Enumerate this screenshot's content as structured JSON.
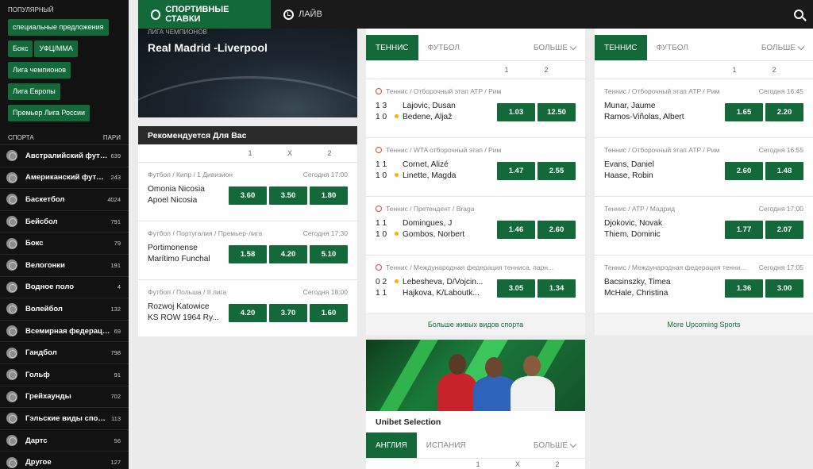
{
  "sidebar": {
    "popular_caption": "ПОПУЛЯРНЫЙ",
    "popular": [
      "специальные предложения",
      "Бокс",
      "УФЦ/ММА",
      "Лига чемпионов",
      "Лига Европы",
      "Премьер Лига России"
    ],
    "sports_caption": "СПОРТА",
    "bets_caption": "ПАРИ",
    "sports": [
      {
        "label": "Австралийский футбол",
        "count": "639",
        "icon": "australian-football-icon"
      },
      {
        "label": "Американский футбол",
        "count": "243",
        "icon": "american-football-icon"
      },
      {
        "label": "Баскетбол",
        "count": "4024",
        "icon": "basketball-icon"
      },
      {
        "label": "Бейсбол",
        "count": "791",
        "icon": "baseball-icon"
      },
      {
        "label": "Бокс",
        "count": "79",
        "icon": "boxing-icon"
      },
      {
        "label": "Велогонки",
        "count": "191",
        "icon": "cycling-icon"
      },
      {
        "label": "Водное поло",
        "count": "4",
        "icon": "water-polo-icon"
      },
      {
        "label": "Волейбол",
        "count": "132",
        "icon": "volleyball-icon"
      },
      {
        "label": "Всемирная федерация р...",
        "count": "69",
        "icon": "rugby-icon"
      },
      {
        "label": "Гандбол",
        "count": "798",
        "icon": "handball-icon"
      },
      {
        "label": "Гольф",
        "count": "91",
        "icon": "golf-icon"
      },
      {
        "label": "Грейхаунды",
        "count": "702",
        "icon": "greyhound-icon"
      },
      {
        "label": "Гэльские виды спорта",
        "count": "113",
        "icon": "gaelic-sports-icon"
      },
      {
        "label": "Дартс",
        "count": "56",
        "icon": "darts-icon"
      },
      {
        "label": "Другое",
        "count": "127",
        "icon": "star-icon"
      }
    ]
  },
  "nav": {
    "sports_bets": "СПОРТИВНЫЕ СТАВКИ",
    "live": "ЛАЙВ"
  },
  "hero": {
    "category": "ЛИГА ЧЕМПИОНОВ",
    "title": "Real Madrid -Liverpool"
  },
  "recommended": {
    "title": "Рекомендуется Для Вас",
    "cols": [
      "1",
      "X",
      "2"
    ],
    "events": [
      {
        "meta": "Футбол / Кипр / 1 Дивизион",
        "time": "Сегодня 17:00",
        "team1": "Omonia Nicosia",
        "team2": "Apoel Nicosia",
        "odds": [
          "3.60",
          "3.50",
          "1.80"
        ]
      },
      {
        "meta": "Футбол / Португалия / Премьер-лига",
        "time": "Сегодня 17:30",
        "team1": "Portimonense",
        "team2": "Marítimo Funchal",
        "odds": [
          "1.58",
          "4.20",
          "5.10"
        ]
      },
      {
        "meta": "Футбол / Польша / II лига",
        "time": "Сегодня 18:00",
        "team1": "Rozwoj Katowice",
        "team2": "KS ROW 1964 Ry...",
        "odds": [
          "4.20",
          "3.70",
          "1.60"
        ]
      }
    ]
  },
  "live_panel": {
    "tabs": [
      "ТЕННИС",
      "ФУТБОЛ",
      "БОЛЬШЕ"
    ],
    "cols": [
      "1",
      "2"
    ],
    "events": [
      {
        "meta": "Теннис / Отборочный этап ATP / Рим",
        "p1": "Lajovic, Dusan",
        "p2": "Bedene, Aljaž",
        "s1": "1 3",
        "s2": "1 0",
        "serve": 2,
        "odds": [
          "1.03",
          "12.50"
        ]
      },
      {
        "meta": "Теннис / WTA отборочный этап / Рим",
        "p1": "Cornet, Alizé",
        "p2": "Linette, Magda",
        "s1": "1 1",
        "s2": "1 0",
        "serve": 2,
        "odds": [
          "1.47",
          "2.55"
        ]
      },
      {
        "meta": "Теннис / Претендент / Braga",
        "p1": "Domingues, J",
        "p2": "Gombos, Norbert",
        "s1": "1 1",
        "s2": "1 0",
        "serve": 2,
        "odds": [
          "1.46",
          "2.60"
        ]
      },
      {
        "meta": "Теннис / Международная федерация тенниса, парн...",
        "p1": "Lebesheva, D/Vojcin...",
        "p2": "Hajkova, K/Laboutk...",
        "s1": "0 2",
        "s2": "1 1",
        "serve": 1,
        "odds": [
          "3.05",
          "1.34"
        ]
      }
    ],
    "more": "Больше живых видов спорта"
  },
  "upcoming_panel": {
    "tabs": [
      "ТЕННИС",
      "ФУТБОЛ",
      "БОЛЬШЕ"
    ],
    "cols": [
      "1",
      "2"
    ],
    "events": [
      {
        "meta": "Теннис / Отборочный этап ATP / Рим",
        "time": "Сегодня 16:45",
        "p1": "Munar, Jaume",
        "p2": "Ramos-Viñolas, Albert",
        "odds": [
          "1.65",
          "2.20"
        ]
      },
      {
        "meta": "Теннис / Отборочный этап ATP / Рим",
        "time": "Сегодня 16:55",
        "p1": "Evans, Daniel",
        "p2": "Haase, Robin",
        "odds": [
          "2.60",
          "1.48"
        ]
      },
      {
        "meta": "Теннис / ATP / Мадрид",
        "time": "Сегодня 17:00",
        "p1": "Djokovic, Novak",
        "p2": "Thiem, Dominic",
        "odds": [
          "1.77",
          "2.07"
        ]
      },
      {
        "meta": "Теннис / Международная федерация тенни...",
        "time": "Сегодня 17:05",
        "p1": "Bacsinszky, Timea",
        "p2": "McHale, Christina",
        "odds": [
          "1.36",
          "3.00"
        ]
      }
    ],
    "more": "More Upcoming Sports"
  },
  "promo": {
    "title": "Unibet Selection",
    "tabs": [
      "АНГЛИЯ",
      "ИСПАНИЯ",
      "БОЛЬШЕ"
    ],
    "cols": [
      "1",
      "X",
      "2"
    ]
  }
}
